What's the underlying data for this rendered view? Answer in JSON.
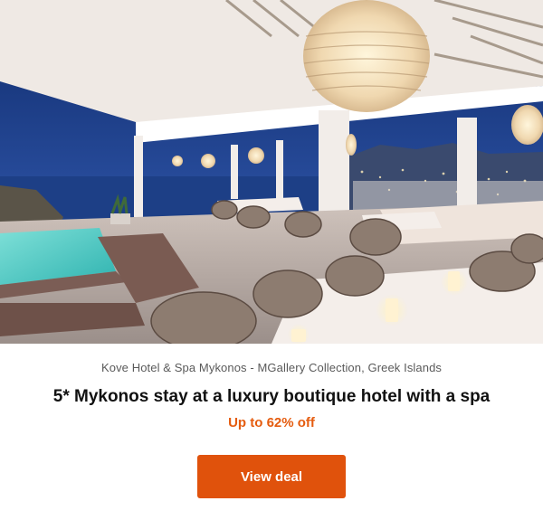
{
  "deal": {
    "image_alt": "Rooftop terrace restaurant with pool overlooking Mykonos at dusk",
    "location": "Kove Hotel & Spa Mykonos - MGallery Collection, Greek Islands",
    "title": "5* Mykonos stay at a luxury boutique hotel with a spa",
    "discount": "Up to 62% off",
    "cta_label": "View deal"
  },
  "colors": {
    "accent": "#e55c0f",
    "button_bg": "#e0520c",
    "title": "#111111",
    "subtitle": "#5a5a5a"
  }
}
